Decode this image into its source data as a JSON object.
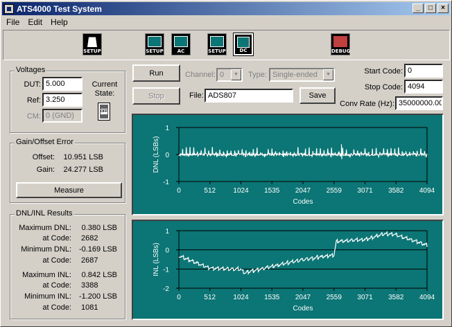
{
  "window": {
    "title": "ATS4000 Test System"
  },
  "menu": {
    "file": "File",
    "edit": "Edit",
    "help": "Help"
  },
  "toolbar": {
    "items": [
      {
        "label": "SETUP"
      },
      {
        "label": "SETUP"
      },
      {
        "label": "AC"
      },
      {
        "label": "SETUP"
      },
      {
        "label": "DC"
      },
      {
        "label": "DEBUG"
      }
    ]
  },
  "voltages": {
    "title": "Voltages",
    "dut_label": "DUT:",
    "dut_value": "5.000",
    "ref_label": "Ref:",
    "ref_value": "3.250",
    "cm_label": "CM:",
    "cm_value": "0 (GND)",
    "current_state_label": "Current State:",
    "switch_state": "OFF"
  },
  "gain_offset": {
    "title": "Gain/Offset Error",
    "offset_label": "Offset:",
    "offset_value": "10.951 LSB",
    "gain_label": "Gain:",
    "gain_value": "24.277 LSB",
    "measure_button": "Measure"
  },
  "dnl_inl": {
    "title": "DNL/INL Results",
    "max_dnl_label": "Maximum DNL:",
    "max_dnl_value": "0.380 LSB",
    "max_dnl_code_label": "at Code:",
    "max_dnl_code": "2682",
    "min_dnl_label": "Minimum DNL:",
    "min_dnl_value": "-0.169 LSB",
    "min_dnl_code_label": "at Code:",
    "min_dnl_code": "2687",
    "max_inl_label": "Maximum INL:",
    "max_inl_value": "0.842 LSB",
    "max_inl_code_label": "at Code:",
    "max_inl_code": "3388",
    "min_inl_label": "Minimum INL:",
    "min_inl_value": "-1.200 LSB",
    "min_inl_code_label": "at Code:",
    "min_inl_code": "1081"
  },
  "controls": {
    "run": "Run",
    "stop": "Stop",
    "channel_label": "Channel:",
    "channel_value": "0",
    "type_label": "Type:",
    "type_value": "Single-ended",
    "file_label": "File:",
    "file_value": "ADS807",
    "save": "Save",
    "start_code_label": "Start Code:",
    "start_code_value": "0",
    "stop_code_label": "Stop Code:",
    "stop_code_value": "4094",
    "conv_rate_label": "Conv Rate (Hz):",
    "conv_rate_value": "35000000.00"
  },
  "chart_data": [
    {
      "type": "line",
      "ylabel": "DNL (LSBs)",
      "xlabel": "Codes",
      "xlim": [
        0,
        4094
      ],
      "ylim": [
        -1,
        1
      ],
      "x_ticks": [
        "0",
        "512",
        "1024",
        "1535",
        "2047",
        "2559",
        "3071",
        "3582",
        "4094"
      ],
      "y_ticks": [
        "1",
        "0",
        "-1"
      ],
      "reference_lines": [
        0
      ],
      "max": {
        "x": 2682,
        "y": 0.38
      },
      "min": {
        "x": 2687,
        "y": -0.169
      }
    },
    {
      "type": "line",
      "ylabel": "INL (LSBs)",
      "xlabel": "Codes",
      "xlim": [
        0,
        4094
      ],
      "ylim": [
        -2,
        1
      ],
      "x_ticks": [
        "0",
        "512",
        "1024",
        "1535",
        "2047",
        "2559",
        "3071",
        "3582",
        "4094"
      ],
      "y_ticks": [
        "1",
        "0",
        "-1",
        "-2"
      ],
      "reference_lines": [
        0,
        -1
      ],
      "trend": [
        {
          "x": 0,
          "y": -0.3
        },
        {
          "x": 512,
          "y": -0.95
        },
        {
          "x": 1024,
          "y": -1.0
        },
        {
          "x": 1081,
          "y": -1.2
        },
        {
          "x": 1535,
          "y": -0.85
        },
        {
          "x": 2047,
          "y": -0.5
        },
        {
          "x": 2559,
          "y": -0.25
        },
        {
          "x": 2600,
          "y": 0.45
        },
        {
          "x": 3071,
          "y": 0.55
        },
        {
          "x": 3388,
          "y": 0.842
        },
        {
          "x": 3582,
          "y": 0.8
        },
        {
          "x": 4094,
          "y": 0.25
        }
      ]
    }
  ]
}
